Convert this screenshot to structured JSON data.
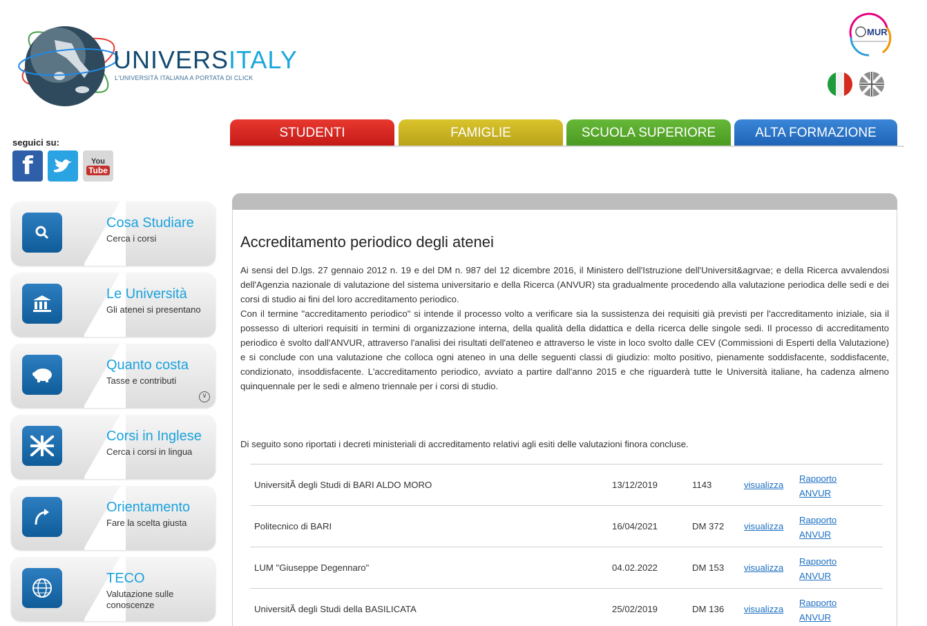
{
  "header": {
    "brand_part1": "UNIVERS",
    "brand_part2": "ITALY",
    "tagline": "L'UNIVERSITÀ ITALIANA A PORTATA DI CLICK",
    "ministry_logo": "MUR",
    "languages": [
      "it-flag-icon",
      "uk-flag-icon"
    ]
  },
  "social": {
    "label": "seguici su:",
    "items": [
      "facebook-icon",
      "twitter-icon",
      "youtube-icon"
    ],
    "youtube_top": "You",
    "youtube_bottom": "Tube"
  },
  "tabs": [
    {
      "label": "STUDENTI",
      "color": "#d8271f"
    },
    {
      "label": "FAMIGLIE",
      "color": "#c9b321"
    },
    {
      "label": "SCUOLA SUPERIORE",
      "color": "#58a92c"
    },
    {
      "label": "ALTA FORMAZIONE",
      "color": "#2a76c9"
    }
  ],
  "sidebar": {
    "items": [
      {
        "title": "Cosa Studiare",
        "subtitle": "Cerca i corsi",
        "icon": "search-icon"
      },
      {
        "title": "Le Università",
        "subtitle": "Gli atenei si presentano",
        "icon": "university-icon"
      },
      {
        "title": "Quanto costa",
        "subtitle": "Tasse e contributi",
        "icon": "piggy-bank-icon"
      },
      {
        "title": "Corsi in Inglese",
        "subtitle": "Cerca i corsi in lingua",
        "icon": "uk-flag-icon"
      },
      {
        "title": "Orientamento",
        "subtitle": "Fare la scelta giusta",
        "icon": "arrow-icon"
      },
      {
        "title": "TECO",
        "subtitle": "Valutazione sulle conoscenze",
        "icon": "globe-icon"
      }
    ]
  },
  "main": {
    "title": "Accreditamento periodico degli atenei",
    "paragraph1": "Ai sensi del D.lgs. 27 gennaio 2012 n. 19 e del DM n. 987 del 12 dicembre 2016, il Ministero dell'Istruzione dell'Universit&agrvae; e della Ricerca avvalendosi dell'Agenzia nazionale di valutazione del sistema universitario e della Ricerca (ANVUR) sta gradualmente procedendo alla valutazione periodica delle sedi e dei corsi di studio ai fini del loro accreditamento periodico.",
    "paragraph2": "Con il termine \"accreditamento periodico\" si intende il processo volto a verificare sia la sussistenza dei requisiti già previsti per l'accreditamento iniziale, sia il possesso di ulteriori requisiti in termini di organizzazione interna, della qualità della didattica e della ricerca delle singole sedi. Il processo di accreditamento periodico è svolto dall'ANVUR, attraverso l'analisi dei risultati dell'ateneo e attraverso le viste in loco svolto dalle CEV (Commissioni di Esperti della Valutazione) e si conclude con una valutazione che colloca ogni ateneo in una delle seguenti classi di giudizio: molto positivo, pienamente soddisfacente, soddisfacente, condizionato, insoddisfacente. L'accreditamento periodico, avviato a partire dall'anno 2015 e che riguarderà tutte le Università italiane, ha cadenza almeno quinquennale per le sedi e almeno triennale per i corsi di studio.",
    "note": "Di seguito sono riportati i decreti ministeriali di accreditamento relativi agli esiti delle valutazioni finora concluse.",
    "rows": [
      {
        "name": "UniversitÃ  degli Studi di BARI ALDO MORO",
        "date": "13/12/2019",
        "dm": "1143",
        "view": "visualizza",
        "report": "Rapporto ANVUR"
      },
      {
        "name": "Politecnico di BARI",
        "date": "16/04/2021",
        "dm": "DM 372",
        "view": "visualizza",
        "report": "Rapporto ANVUR"
      },
      {
        "name": "LUM \"Giuseppe Degennaro\"",
        "date": "04.02.2022",
        "dm": "DM 153",
        "view": "visualizza",
        "report": "Rapporto ANVUR"
      },
      {
        "name": "UniversitÃ  degli Studi della BASILICATA",
        "date": "25/02/2019",
        "dm": "DM 136",
        "view": "visualizza",
        "report": "Rapporto ANVUR"
      }
    ]
  }
}
